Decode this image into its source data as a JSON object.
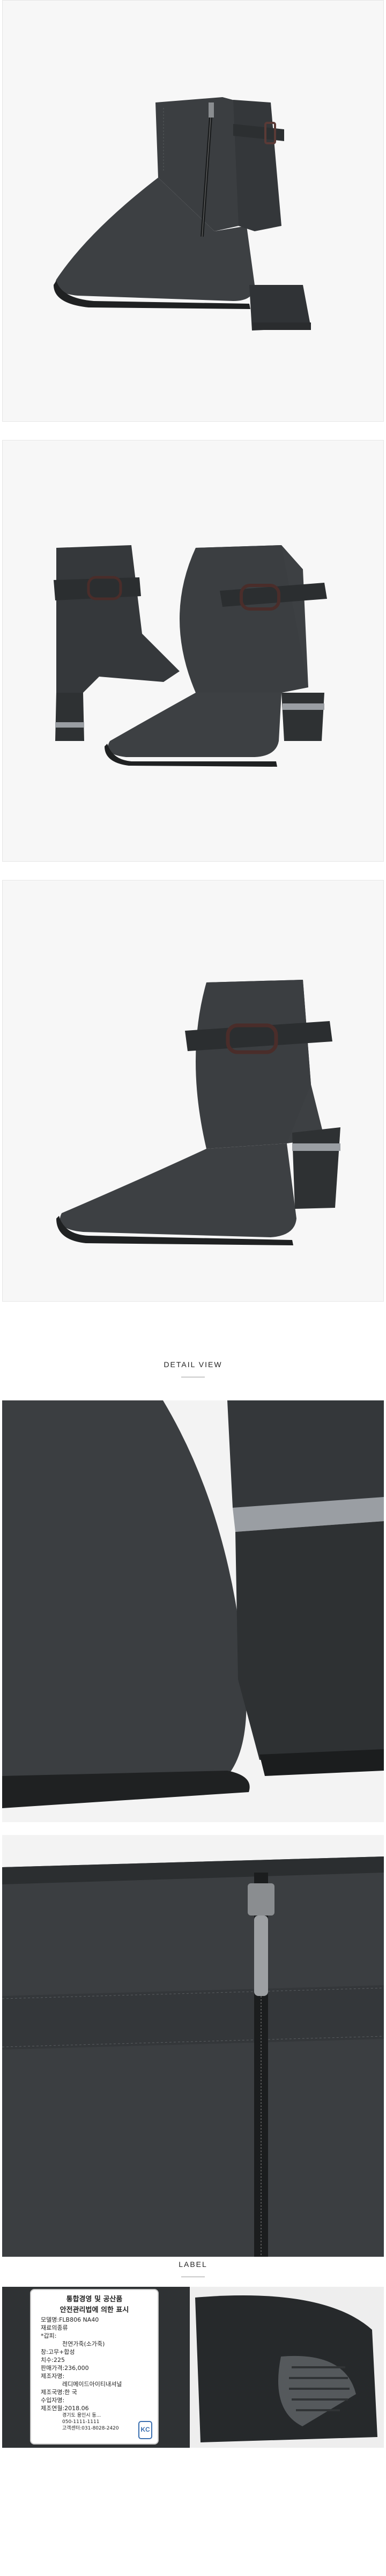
{
  "sections": {
    "detail_view": "DETAIL VIEW",
    "label": "LABEL"
  },
  "product_label": {
    "heading_line1": "통합경영 및 공산품",
    "heading_line2": "안전관리법에 의한 표시",
    "lines": [
      "모델명:FLB806 NA40",
      "재료의종류",
      "*갑피:",
      "천연가죽(소가죽)",
      "창:고무+합성",
      "치수:225",
      "판매가격:236,000",
      "제조자명:",
      "레디메이드아이티내셔널",
      "제조국명:한 국",
      "수입자명:",
      "제조연월:2018.06",
      "경기도 용인시 동...",
      "050-1111-1111",
      "고객센터:031-8028-2420"
    ],
    "cert_mark": "KC"
  },
  "colors": {
    "leather": "#3b3e41",
    "leather_dark": "#26292b",
    "heel_metal": "#9a9ea3",
    "buckle": "#4a2d2a",
    "panel_bg": "#f7f7f7"
  },
  "icons": [
    "boot-side-photo",
    "boot-pair-photo",
    "boot-front-photo",
    "toe-detail-photo",
    "zipper-detail-photo",
    "label-photo",
    "sole-photo",
    "kc-cert-icon"
  ]
}
